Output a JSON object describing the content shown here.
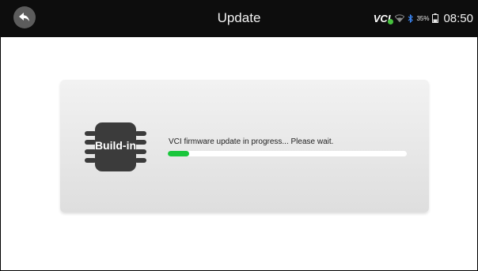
{
  "header": {
    "title": "Update",
    "back_icon": "back-arrow-icon",
    "status": {
      "vci_label": "VCI",
      "vci_connected_color": "#47c23e",
      "battery_percent": "35%",
      "time": "08:50"
    }
  },
  "dialog": {
    "chip_label": "Build-in",
    "message": "VCI firmware update in progress... Please wait.",
    "progress_fraction": 0.09,
    "progress_color": "#19c63b"
  }
}
